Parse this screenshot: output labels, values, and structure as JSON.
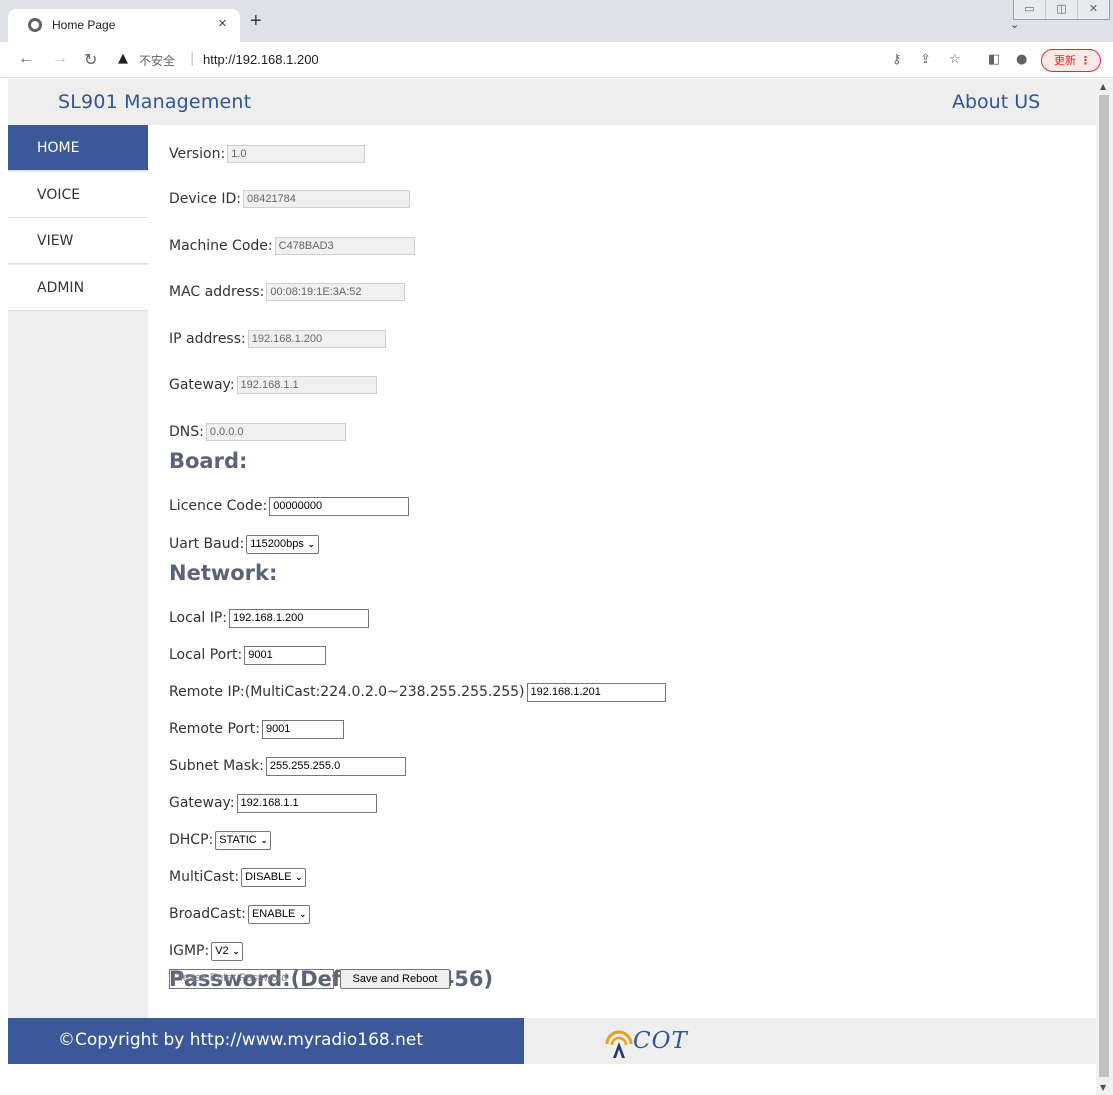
{
  "browser": {
    "tab_title": "Home Page",
    "tab_close": "×",
    "new_tab": "+",
    "security_label": "不安全",
    "url": "http://192.168.1.200",
    "update_label": "更新"
  },
  "header": {
    "brand": "SL901 Management",
    "about": "About US"
  },
  "sidebar": {
    "items": [
      {
        "label": "HOME"
      },
      {
        "label": "VOICE"
      },
      {
        "label": "VIEW"
      },
      {
        "label": "ADMIN"
      }
    ]
  },
  "info": {
    "version_label": "Version:",
    "version": "1.0",
    "device_id_label": "Device ID:",
    "device_id": "08421784",
    "machine_code_label": "Machine Code:",
    "machine_code": "C478BAD3",
    "mac_label": "MAC address:",
    "mac": "00:08:19:1E:3A:52",
    "ip_label": "IP address:",
    "ip": "192.168.1.200",
    "gateway_label": "Gateway:",
    "gateway": "192.168.1.1",
    "dns_label": "DNS:",
    "dns": "0.0.0.0"
  },
  "board": {
    "heading": "Board:",
    "licence_label": "Licence Code:",
    "licence": "00000000",
    "uart_label": "Uart Baud:",
    "uart": "115200bps"
  },
  "network": {
    "heading": "Network:",
    "local_ip_label": "Local IP:",
    "local_ip": "192.168.1.200",
    "local_port_label": "Local Port:",
    "local_port": "9001",
    "remote_ip_label": "Remote IP:(MultiCast:224.0.2.0~238.255.255.255)",
    "remote_ip": "192.168.1.201",
    "remote_port_label": "Remote Port:",
    "remote_port": "9001",
    "subnet_label": "Subnet Mask:",
    "subnet": "255.255.255.0",
    "gateway_label": "Gateway:",
    "gateway": "192.168.1.1",
    "dhcp_label": "DHCP:",
    "dhcp": "STATIC",
    "multicast_label": "MultiCast:",
    "multicast": "DISABLE",
    "broadcast_label": "BroadCast:",
    "broadcast": "ENABLE",
    "igmp_label": "IGMP:",
    "igmp": "V2"
  },
  "password": {
    "heading": "Password:(Default:123456)",
    "placeholder": "Please Enter Password",
    "save_label": "Save and Reboot"
  },
  "footer": {
    "copyright": "©Copyright by http://www.myradio168.net",
    "logo_text": "COT"
  }
}
